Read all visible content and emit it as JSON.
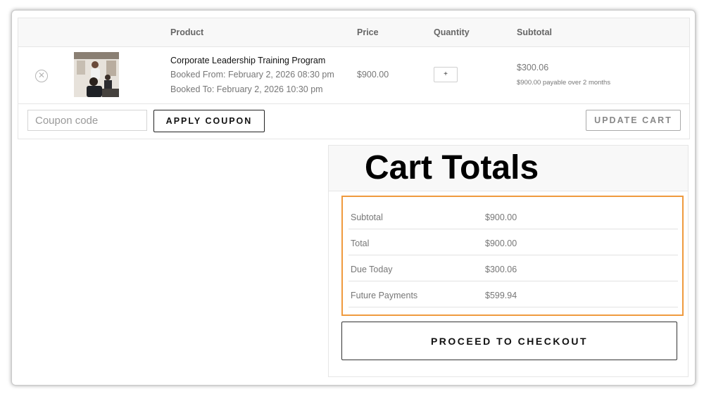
{
  "cart": {
    "headers": {
      "product": "Product",
      "price": "Price",
      "quantity": "Quantity",
      "subtotal": "Subtotal"
    },
    "item": {
      "remove_icon": "close-circle-icon",
      "name": "Corporate Leadership Training Program",
      "booked_from": "Booked From: February 2, 2026 08:30 pm",
      "booked_to": "Booked To: February 2, 2026 10:30 pm",
      "price": "$900.00",
      "quantity": "+",
      "subtotal": "$300.06",
      "subtotal_note": "$900.00 payable over 2 months"
    },
    "coupon": {
      "placeholder": "Coupon code",
      "value": ""
    },
    "apply_coupon_label": "APPLY COUPON",
    "update_cart_label": "UPDATE CART"
  },
  "totals": {
    "title": "Cart Totals",
    "rows": [
      {
        "label": "Subtotal",
        "value": "$900.00"
      },
      {
        "label": "Total",
        "value": "$900.00"
      },
      {
        "label": "Due Today",
        "value": "$300.06"
      },
      {
        "label": "Future Payments",
        "value": "$599.94"
      }
    ],
    "checkout_label": "PROCEED TO CHECKOUT"
  },
  "colors": {
    "highlight_border": "#ef9a3e",
    "muted_text": "#777777",
    "header_bg": "#f8f8f8"
  }
}
